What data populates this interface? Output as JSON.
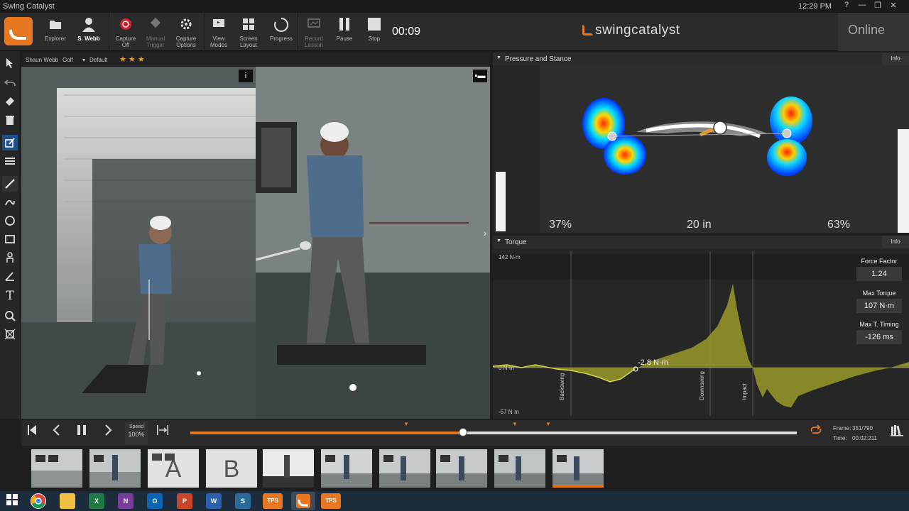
{
  "window": {
    "title": "Swing Catalyst",
    "clock": "12:29 PM"
  },
  "toolbar": {
    "explorer": "Explorer",
    "user": "S. Webb",
    "capture_off": [
      "Capture",
      "Off"
    ],
    "manual_trigger": [
      "Manual",
      "Trigger"
    ],
    "capture_options": [
      "Capture",
      "Options"
    ],
    "view_modes": [
      "View",
      "Modes"
    ],
    "screen_layout": [
      "Screen",
      "Layout"
    ],
    "progress": "Progress",
    "record_lesson": [
      "Record",
      "Lesson"
    ],
    "pause": "Pause",
    "stop": "Stop",
    "timer": "00:09",
    "brand": "swingcatalyst",
    "online": "Online"
  },
  "video_bar": {
    "player": "Shaun Webb",
    "sport": "Golf",
    "preset": "Default",
    "stars": "★ ★ ★"
  },
  "pressure": {
    "title": "Pressure and Stance",
    "info": "Info",
    "left_pct": "37%",
    "stance": "20 in",
    "right_pct": "63%"
  },
  "torque": {
    "title": "Torque",
    "info": "Info",
    "y_max": "142 N·m",
    "y_zero": "0 N·m",
    "y_min": "-57 N·m",
    "marker_value": "-2.8 N·m",
    "events": [
      "Backswing",
      "Downswing",
      "Impact"
    ],
    "force_factor_label": "Force Factor",
    "force_factor": "1.24",
    "max_torque_label": "Max Torque",
    "max_torque": "107 N·m",
    "max_timing_label": "Max T. Timing",
    "max_timing": "-126 ms"
  },
  "playback": {
    "speed_label": "Speed",
    "speed_value": "100%",
    "progress": 0.45,
    "frame_label": "Frame:",
    "frame": "351/790",
    "time_label": "Time:",
    "time": "00:02:211"
  },
  "thumbnails": [
    "",
    "",
    "A",
    "B",
    "",
    "",
    "",
    "",
    "",
    ""
  ],
  "taskbar": [
    "chrome",
    "explorer",
    "excel",
    "onenote",
    "outlook",
    "powerpoint",
    "word",
    "swing",
    "TPS",
    "catalyst",
    "TPS"
  ],
  "colors": {
    "accent": "#e87722",
    "torque_fill": "#9a9a2a"
  }
}
